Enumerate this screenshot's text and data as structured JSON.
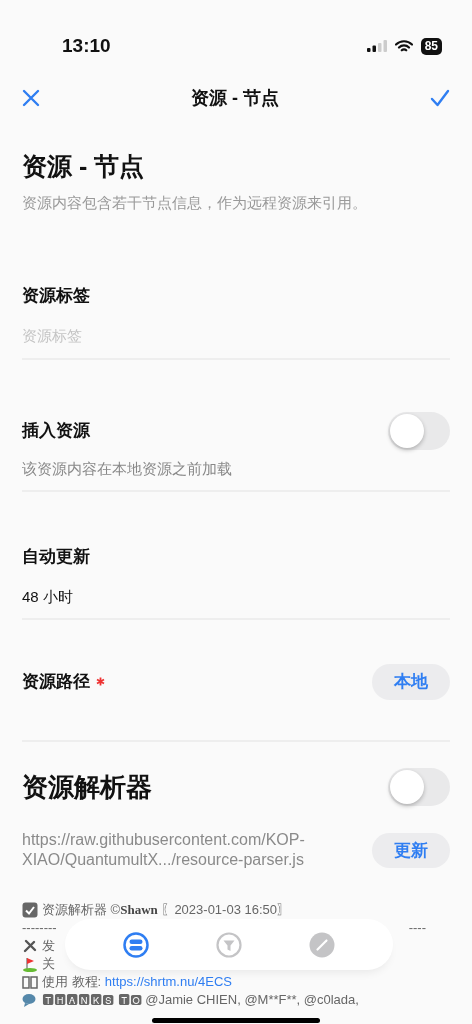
{
  "status_bar": {
    "time": "13:10",
    "battery": "85"
  },
  "nav": {
    "title": "资源 - 节点"
  },
  "header": {
    "title": "资源 - 节点",
    "subtitle": "资源内容包含若干节点信息，作为远程资源来引用。"
  },
  "fields": [
    {
      "kind": "text",
      "label": "资源标签",
      "placeholder": "资源标签"
    },
    {
      "kind": "toggle",
      "label": "插入资源",
      "on": false,
      "hint": "该资源内容在本地资源之前加载"
    },
    {
      "kind": "value",
      "label": "自动更新",
      "value": "48 小时"
    },
    {
      "kind": "button",
      "label": "资源路径",
      "required": true,
      "button": "本地"
    }
  ],
  "parser": {
    "title": "资源解析器",
    "on": false,
    "url": "https://raw.githubusercontent.com/KOP-XIAO/QuantumultX.../resource-parser.js",
    "button": "更新"
  },
  "notes": [
    {
      "kind": "check",
      "text": "资源解析器 ©**Shawn** 〖2023-01-03 16:50〗"
    },
    {
      "kind": "rule",
      "left": "--------",
      "right": "----"
    },
    {
      "kind": "tools",
      "text": "发"
    },
    {
      "kind": "flag",
      "text": "关"
    },
    {
      "kind": "book",
      "text": "使用 教程: ",
      "link": "https://shrtm.nu/4ECS"
    },
    {
      "kind": "speech",
      "text": "🆃🅷🅰🅽🅺🆂 🆃🅾  @Jamie CHIEN, @M**F**, @c0lada,"
    }
  ],
  "tab_bar": [
    {
      "selected": true
    },
    {
      "selected": false
    },
    {
      "selected": false
    }
  ]
}
